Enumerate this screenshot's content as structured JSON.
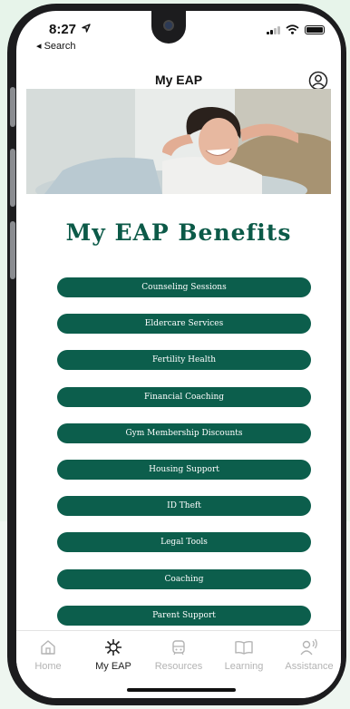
{
  "status_bar": {
    "time": "8:27",
    "back_label": "◂ Search"
  },
  "header": {
    "title": "My EAP",
    "profile_icon": "profile-icon"
  },
  "hero": {
    "description_icon": "woman-relaxing-photo"
  },
  "page_title": "My EAP Benefits",
  "benefits": [
    {
      "label": "Counseling Sessions"
    },
    {
      "label": "Eldercare Services"
    },
    {
      "label": "Fertility Health"
    },
    {
      "label": "Financial Coaching"
    },
    {
      "label": "Gym Membership Discounts"
    },
    {
      "label": "Housing Support"
    },
    {
      "label": "ID Theft"
    },
    {
      "label": "Legal Tools"
    },
    {
      "label": "Coaching"
    },
    {
      "label": "Parent Support"
    }
  ],
  "tabs": [
    {
      "label": "Home",
      "icon": "home-icon"
    },
    {
      "label": "My EAP",
      "icon": "eap-logo-icon",
      "active": true
    },
    {
      "label": "Resources",
      "icon": "resources-icon"
    },
    {
      "label": "Learning",
      "icon": "book-icon"
    },
    {
      "label": "Assistance",
      "icon": "assistance-icon"
    }
  ],
  "colors": {
    "brand": "#0c5e4c",
    "title": "#0c5a48",
    "tab_inactive": "#b3b3b3"
  }
}
